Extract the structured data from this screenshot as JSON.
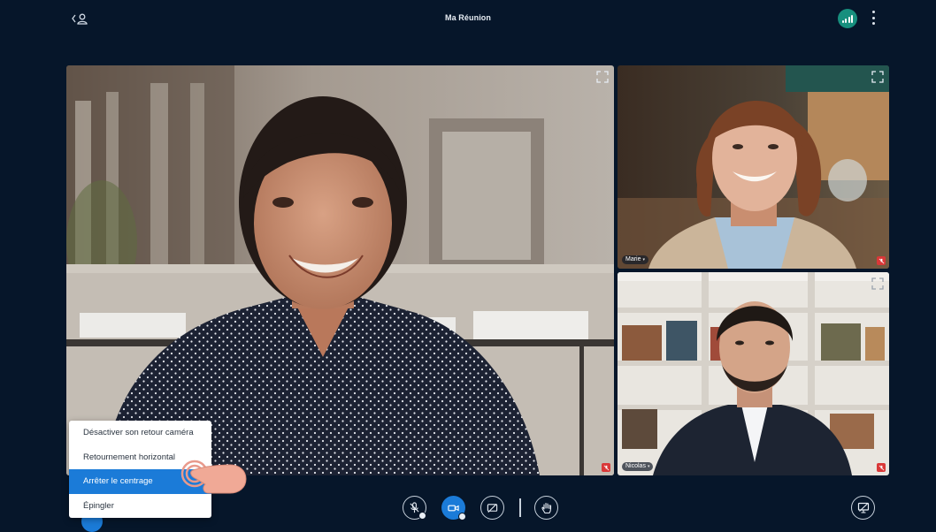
{
  "header": {
    "title": "Ma Réunion",
    "back_icon": "back-profile-icon",
    "signal_icon": "signal-bars-icon",
    "more_icon": "more-vertical-icon",
    "signal_color": "#178f7e"
  },
  "participants": {
    "marie": {
      "name": "Marie"
    },
    "nicolas": {
      "name": "Nicolas"
    }
  },
  "context_menu": {
    "items": [
      {
        "label": "Désactiver son retour caméra"
      },
      {
        "label": "Retournement horizontal"
      },
      {
        "label": "Arrêter le centrage"
      },
      {
        "label": "Épingler"
      }
    ],
    "active_color": "#1b7bd8"
  },
  "controls": {
    "mic_icon": "mic-off-icon",
    "camera_icon": "video-camera-icon",
    "screen_share_icon": "screen-share-off-icon",
    "raise_hand_icon": "raise-hand-icon",
    "present_icon": "presentation-icon"
  },
  "colors": {
    "background": "#06162a",
    "accent": "#1b7bd8",
    "muted_badge": "#d93838"
  }
}
